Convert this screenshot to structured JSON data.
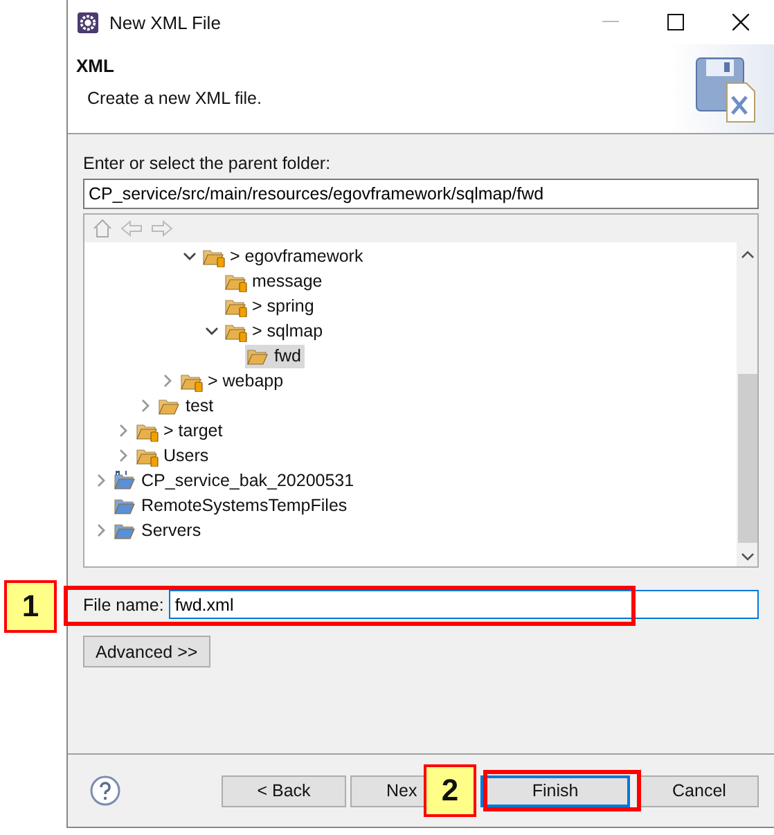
{
  "window": {
    "title": "New XML File"
  },
  "header": {
    "title": "XML",
    "description": "Create a new XML file."
  },
  "parent_folder": {
    "label": "Enter or select the parent folder:",
    "value": "CP_service/src/main/resources/egovframework/sqlmap/fwd"
  },
  "tree": {
    "items": [
      {
        "children": [
          {
            "children": [
              {
                "children": [
                  {
                    "children": [
                      {
                        "label": "> egovframework",
                        "kind": "source-folder",
                        "expanded": true,
                        "selected": false,
                        "children": [
                          {
                            "label": "message",
                            "kind": "source-folder",
                            "selected": false
                          },
                          {
                            "label": "> spring",
                            "kind": "source-folder",
                            "selected": false
                          },
                          {
                            "label": "> sqlmap",
                            "kind": "source-folder",
                            "expanded": true,
                            "selected": false,
                            "children": [
                              {
                                "label": "fwd",
                                "kind": "folder",
                                "selected": true
                              }
                            ]
                          }
                        ]
                      }
                    ]
                  },
                  {
                    "label": "> webapp",
                    "kind": "source-folder",
                    "expanded": false,
                    "selected": false
                  }
                ]
              },
              {
                "label": "test",
                "kind": "folder",
                "expanded": false,
                "selected": false
              }
            ]
          },
          {
            "label": "> target",
            "kind": "source-folder",
            "expanded": false,
            "selected": false
          },
          {
            "label": "Users",
            "kind": "source-folder",
            "expanded": false,
            "selected": false
          }
        ]
      },
      {
        "label": "CP_service_bak_20200531",
        "kind": "project",
        "expanded": false,
        "selected": false
      },
      {
        "label": "RemoteSystemsTempFiles",
        "kind": "blue-folder",
        "selected": false
      },
      {
        "label": "Servers",
        "kind": "blue-folder",
        "expanded": false,
        "selected": false
      }
    ]
  },
  "file_name": {
    "label": "File name:",
    "value": "fwd.xml"
  },
  "advanced_button": "Advanced >>",
  "buttons": [
    {
      "label": "< Back",
      "default": false
    },
    {
      "label": "Nex",
      "default": false
    },
    {
      "label": "Finish",
      "default": true
    },
    {
      "label": "Cancel",
      "default": false
    }
  ],
  "callouts": [
    {
      "label": "1"
    },
    {
      "label": "2"
    }
  ]
}
